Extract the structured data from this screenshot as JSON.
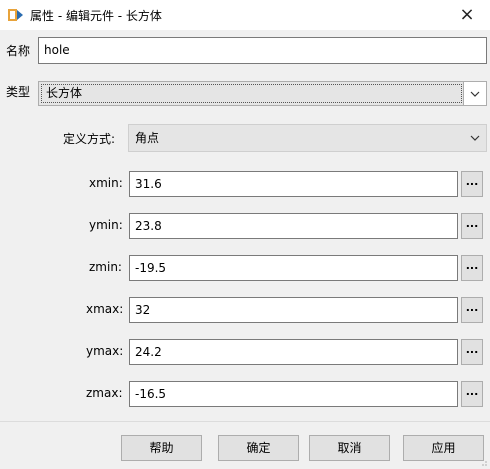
{
  "window": {
    "title": "属性 - 编辑元件 - 长方体",
    "close_glyph": "×"
  },
  "name_field": {
    "label": "名称",
    "value": "hole"
  },
  "type_field": {
    "label": "类型",
    "value": "长方体"
  },
  "definition": {
    "label": "定义方式:",
    "value": "角点"
  },
  "params": [
    {
      "label": "xmin:",
      "value": "31.6"
    },
    {
      "label": "ymin:",
      "value": "23.8"
    },
    {
      "label": "zmin:",
      "value": "-19.5"
    },
    {
      "label": "xmax:",
      "value": "32"
    },
    {
      "label": "ymax:",
      "value": "24.2"
    },
    {
      "label": "zmax:",
      "value": "-16.5"
    }
  ],
  "ellipsis_label": "...",
  "buttons": {
    "help": "帮助",
    "ok": "确定",
    "cancel": "取消",
    "apply": "应用"
  },
  "colors": {
    "accent": "#0078d7",
    "app_icon_orange": "#e8a33b",
    "app_icon_blue": "#2b6cb0"
  }
}
